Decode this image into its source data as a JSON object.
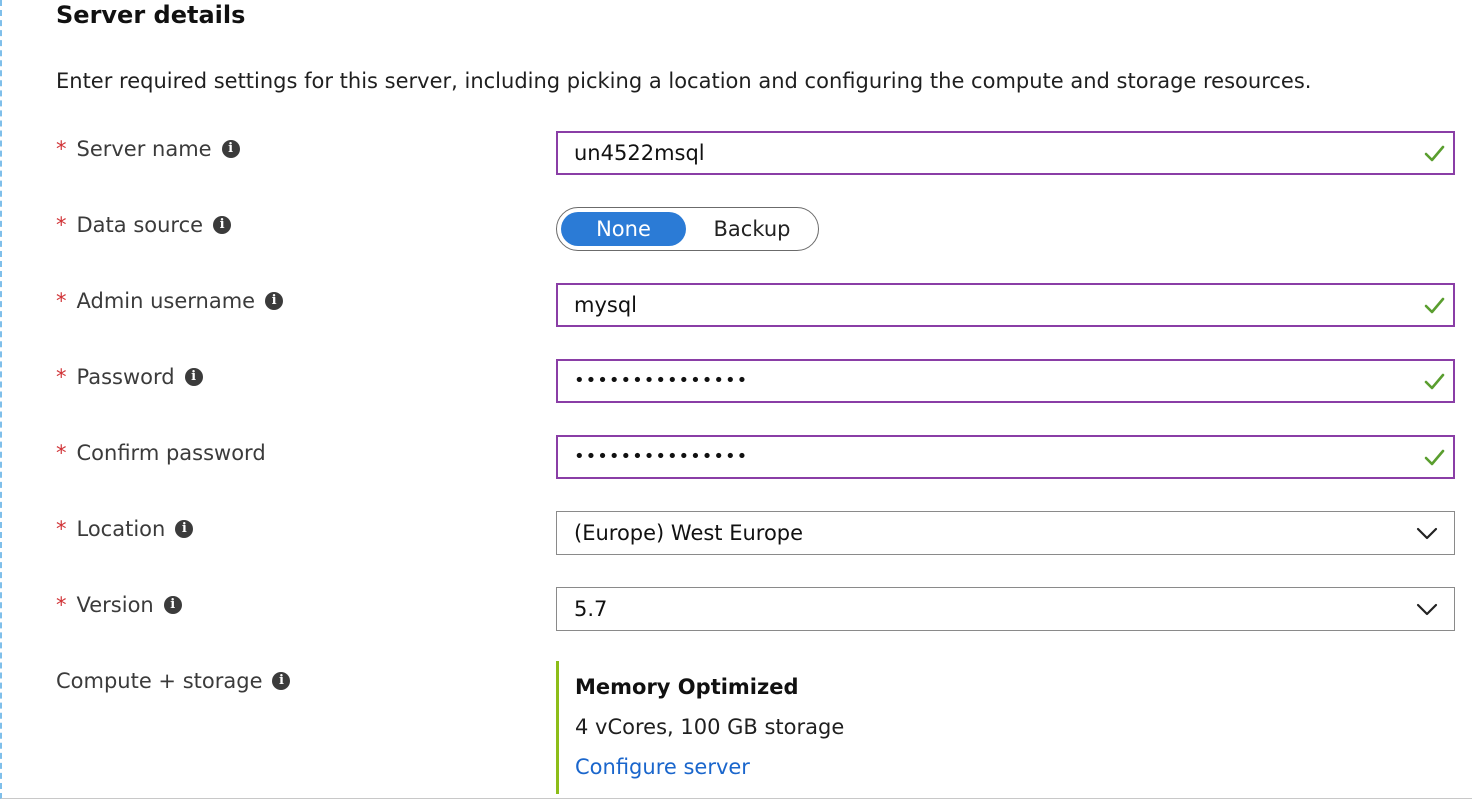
{
  "section": {
    "title": "Server details",
    "description": "Enter required settings for this server, including picking a location and configuring the compute and storage resources."
  },
  "fields": {
    "server_name": {
      "label": "Server name",
      "required": "*",
      "value": "un4522msql"
    },
    "data_source": {
      "label": "Data source",
      "required": "*",
      "options": [
        "None",
        "Backup"
      ],
      "selected": "None"
    },
    "admin_username": {
      "label": "Admin username",
      "required": "*",
      "value": "mysql"
    },
    "password": {
      "label": "Password",
      "required": "*",
      "value": "•••••••••••••••"
    },
    "confirm_password": {
      "label": "Confirm password",
      "required": "*",
      "value": "•••••••••••••••"
    },
    "location": {
      "label": "Location",
      "required": "*",
      "value": "(Europe) West Europe"
    },
    "version": {
      "label": "Version",
      "required": "*",
      "value": "5.7"
    }
  },
  "compute": {
    "label": "Compute + storage",
    "tier": "Memory Optimized",
    "detail": "4 vCores, 100 GB storage",
    "link": "Configure server"
  },
  "icons": {
    "info": "info-icon",
    "valid": "check-icon",
    "dropdown": "chevron-down-icon"
  },
  "colors": {
    "required": "#d13438",
    "field_border": "#8a3ea6",
    "valid_check": "#5a9e2f",
    "toggle_selected": "#2b7bd6",
    "compute_accent": "#8cbd18",
    "link": "#1a66cc"
  }
}
